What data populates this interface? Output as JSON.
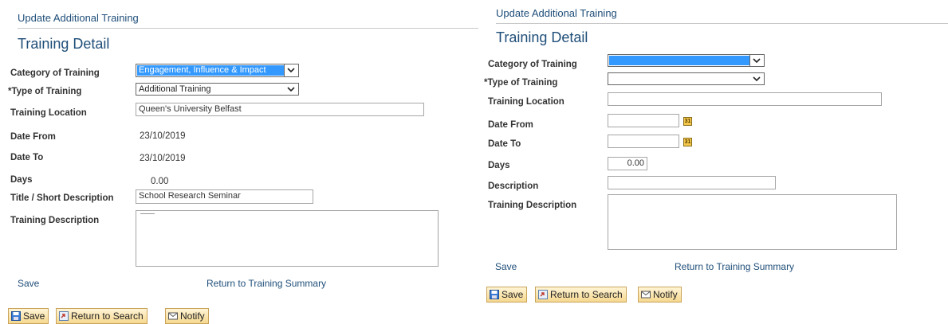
{
  "left": {
    "page_heading": "Update Additional  Training",
    "section_title": "Training Detail",
    "labels": {
      "category": "Category of Training",
      "type": "*Type of Training",
      "location": "Training Location",
      "date_from": "Date From",
      "date_to": "Date To",
      "days": "Days",
      "title_short": "Title / Short Description",
      "training_description": "Training Description"
    },
    "values": {
      "category": "Engagement, Influence & Impact",
      "type": "Additional Training",
      "location": "Queen's University Belfast",
      "date_from": "23/10/2019",
      "date_to": "23/10/2019",
      "days": "0.00",
      "title_short": "School Research Seminar",
      "training_description": ""
    },
    "links": {
      "save": "Save",
      "return_summary": "Return to Training Summary"
    },
    "toolbar": {
      "save": "Save",
      "return_search": "Return to Search",
      "notify": "Notify"
    }
  },
  "right": {
    "page_heading": "Update Additional  Training",
    "section_title": "Training Detail",
    "labels": {
      "category": "Category of Training",
      "type": "*Type of Training",
      "location": "Training Location",
      "date_from": "Date From",
      "date_to": "Date To",
      "days": "Days",
      "description": "Description",
      "training_description": "Training Description"
    },
    "values": {
      "category": "",
      "type": "",
      "location": "",
      "date_from": "",
      "date_to": "",
      "days": "0.00",
      "description": "",
      "training_description": ""
    },
    "links": {
      "save": "Save",
      "return_summary": "Return to Training Summary"
    },
    "toolbar": {
      "save": "Save",
      "return_search": "Return to Search",
      "notify": "Notify"
    }
  },
  "colors": {
    "link": "#1f4e79",
    "select_highlight": "#3399ff",
    "button_gradient_top": "#fff4d6",
    "button_gradient_bottom": "#f6d88f"
  }
}
